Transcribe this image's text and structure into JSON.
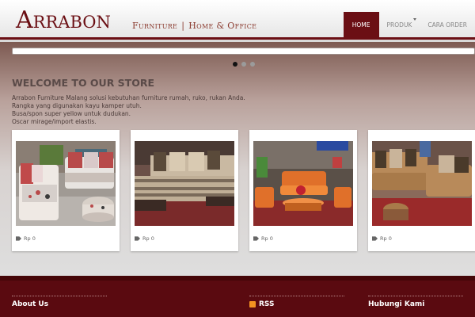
{
  "brand": {
    "name": "Arrabon",
    "tagline_left": "Furniture",
    "tagline_right": "Home & Office",
    "separator": "|"
  },
  "nav": {
    "items": [
      {
        "label": "HOME",
        "active": true
      },
      {
        "label": "PRODUK",
        "has_dropdown": true
      },
      {
        "label": "CARA ORDER"
      }
    ]
  },
  "slider": {
    "dot_count": 3,
    "active_dot": 1
  },
  "welcome": {
    "title": "WELCOME TO OUR STORE",
    "lines": [
      "Arrabon Furniture Malang solusi kebutuhan furniture rumah, ruko, rukan Anda.",
      "Rangka yang digunakan kayu kamper utuh.",
      "Busa/spon super yellow untuk dudukan.",
      "Oscar mirage/import elastis."
    ]
  },
  "products": [
    {
      "price": "Rp 0",
      "photo": "sofa-white-patterned-icon"
    },
    {
      "price": "Rp 0",
      "photo": "sofa-beige-striped-icon"
    },
    {
      "price": "Rp 0",
      "photo": "sofa-orange-set-icon"
    },
    {
      "price": "Rp 0",
      "photo": "sofa-brown-sectional-icon"
    }
  ],
  "footer": {
    "about": "About Us",
    "rss": "RSS",
    "contact": "Hubungi Kami"
  },
  "colors": {
    "accent": "#6b0f14",
    "footer_bg": "#5a0a10",
    "rss": "#f29221"
  }
}
